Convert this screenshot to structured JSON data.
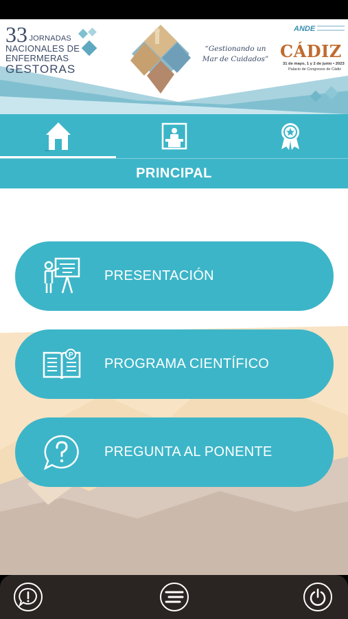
{
  "banner": {
    "logo_number": "33",
    "logo_line1": "JORNADAS",
    "logo_line2": "NACIONALES DE",
    "logo_line3": "ENFERMERAS",
    "logo_line4": "GESTORAS",
    "slogan_line1": "“Gestionando un",
    "slogan_line2": "Mar de Cuidados”",
    "ande_label": "ANDE",
    "city": "CÁDIZ",
    "city_dates": "31 de mayo, 1 y 2 de junio • 2023",
    "city_venue": "Palacio de Congresos de Cádiz"
  },
  "nav": {
    "tabs": [
      {
        "icon": "home-icon",
        "active": true
      },
      {
        "icon": "speaker-podium-icon",
        "active": false
      },
      {
        "icon": "award-ribbon-icon",
        "active": false
      }
    ]
  },
  "section": {
    "title": "PRINCIPAL"
  },
  "menu": {
    "items": [
      {
        "label": "PRESENTACIÓN",
        "icon": "presenter-board-icon"
      },
      {
        "label": "PROGRAMA CIENTÍFICO",
        "icon": "open-book-icon"
      },
      {
        "label": "PREGUNTA AL PONENTE",
        "icon": "question-bubble-icon"
      }
    ]
  },
  "bottom_bar": {
    "buttons": [
      {
        "icon": "alert-bubble-icon"
      },
      {
        "icon": "menu-lines-icon"
      },
      {
        "icon": "power-icon"
      }
    ]
  },
  "colors": {
    "accent": "#3db5c8",
    "bottom_bar": "#2a2422",
    "text_dark": "#3b4a66",
    "cadiz": "#c06a2e"
  }
}
